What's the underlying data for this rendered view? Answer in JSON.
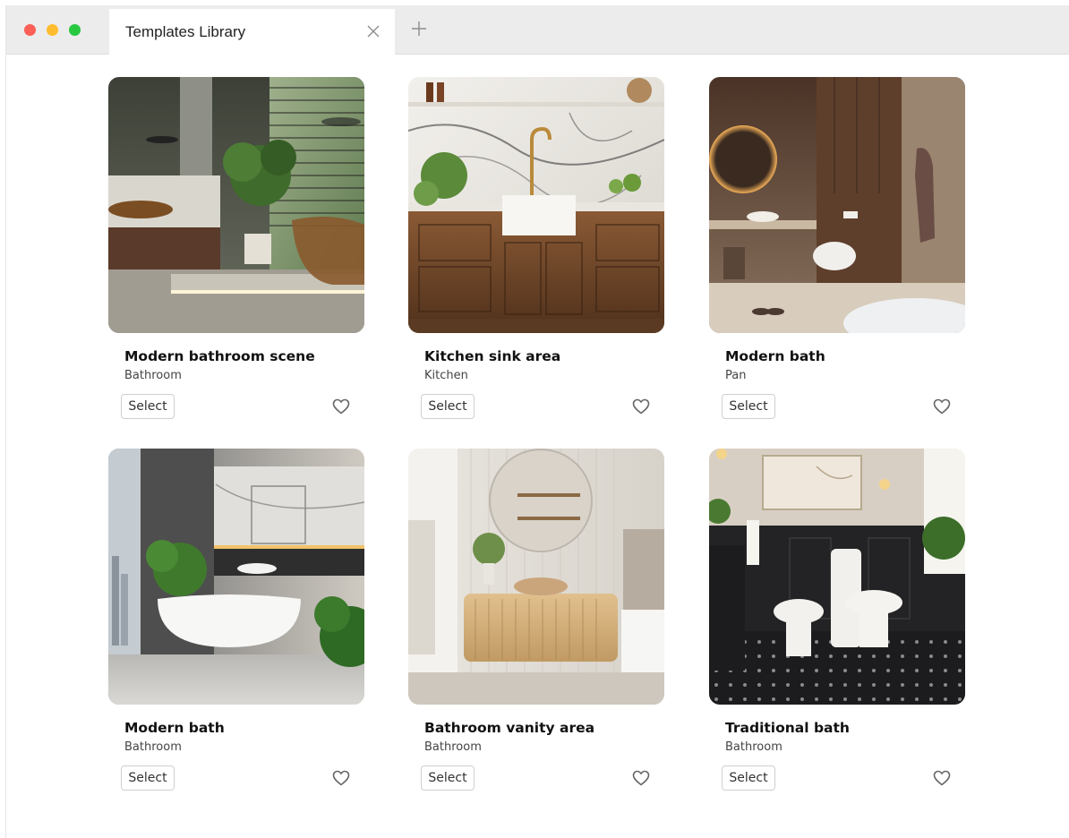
{
  "window": {
    "tab_title": "Templates Library",
    "close_icon": "close-icon",
    "new_tab_icon": "plus-icon"
  },
  "templates": [
    {
      "title": "Modern bathroom scene",
      "category": "Bathroom",
      "select_label": "Select",
      "favorite_icon": "heart-icon"
    },
    {
      "title": "Kitchen sink area",
      "category": "Kitchen",
      "select_label": "Select",
      "favorite_icon": "heart-icon"
    },
    {
      "title": "Modern bath",
      "category": "Pan",
      "select_label": "Select",
      "favorite_icon": "heart-icon"
    },
    {
      "title": "Modern bath",
      "category": "Bathroom",
      "select_label": "Select",
      "favorite_icon": "heart-icon"
    },
    {
      "title": "Bathroom vanity area",
      "category": "Bathroom",
      "select_label": "Select",
      "favorite_icon": "heart-icon"
    },
    {
      "title": "Traditional bath",
      "category": "Bathroom",
      "select_label": "Select",
      "favorite_icon": "heart-icon"
    }
  ],
  "colors": {
    "close_dot": "#fe5f57",
    "minimize_dot": "#febc2e",
    "zoom_dot": "#28c840",
    "titlebar": "#ececec"
  }
}
